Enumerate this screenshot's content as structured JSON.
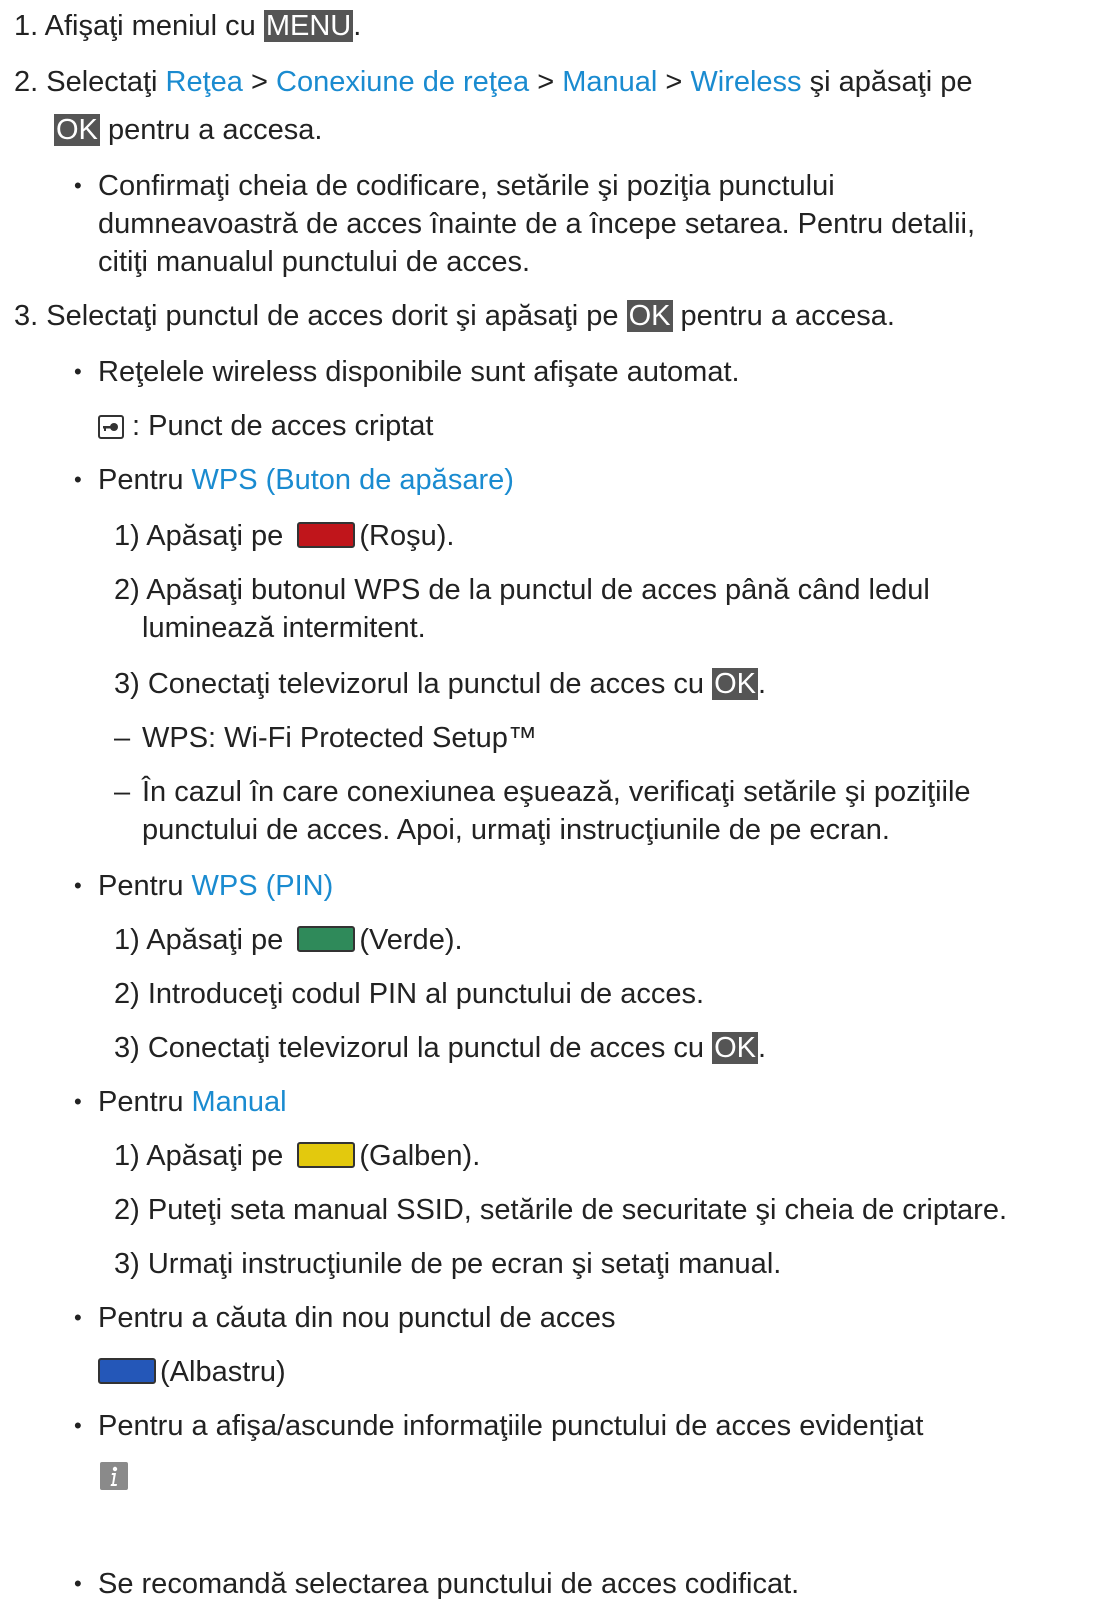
{
  "steps": [
    {
      "num": "1.",
      "pre": "Afişaţi meniul cu ",
      "key": "MENU",
      "post": "."
    },
    {
      "num": "2.",
      "pre": "Selectaţi ",
      "path": [
        "Reţea",
        "Conexiune de reţea",
        "Manual",
        "Wireless"
      ],
      "sep": " > ",
      "post": " şi apăsaţi pe",
      "key": "OK",
      "post2": " pentru a accesa.",
      "note": [
        "Confirmaţi cheia de codificare, setările şi poziţia punctului",
        "dumneavoastră de acces înainte de a începe setarea. Pentru detalii,",
        "citiţi manualul punctului de acces."
      ]
    },
    {
      "num": "3.",
      "pre": "Selectaţi punctul de acces dorit şi apăsaţi pe ",
      "key": "OK",
      "post": " pentru a accesa."
    }
  ],
  "step3": {
    "auto_note": "Reţelele wireless disponibile sunt afişate automat.",
    "lock_note": " : Punct de acces criptat",
    "wps_button": {
      "pre": "Pentru ",
      "link": "WPS (Buton de apăsare)",
      "s1_num": "1)",
      "s1_pre": "Apăsaţi pe ",
      "s1_post": "(Roşu).",
      "s2_num": "2)",
      "s2": [
        "Apăsaţi butonul WPS de la punctul de acces până când ledul",
        "luminează intermitent."
      ],
      "s3_num": "3)",
      "s3_pre": "Conectaţi televizorul la punctul de acces cu ",
      "s3_key": "OK",
      "s3_post": ".",
      "dash1": "WPS: Wi-Fi Protected Setup™",
      "dash2": [
        "În cazul în care conexiunea eşuează, verificaţi setările şi poziţiile",
        "punctului de acces. Apoi, urmaţi instrucţiunile de pe ecran."
      ]
    },
    "wps_pin": {
      "pre": "Pentru ",
      "link": "WPS (PIN)",
      "s1_num": "1)",
      "s1_pre": "Apăsaţi pe ",
      "s1_post": "(Verde).",
      "s2_num": "2)",
      "s2": "Introduceţi codul PIN al punctului de acces.",
      "s3_num": "3)",
      "s3_pre": "Conectaţi televizorul la punctul de acces cu ",
      "s3_key": "OK",
      "s3_post": "."
    },
    "manual": {
      "pre": "Pentru ",
      "link": "Manual",
      "s1_num": "1)",
      "s1_pre": "Apăsaţi pe ",
      "s1_post": "(Galben).",
      "s2_num": "2)",
      "s2": "Puteţi seta manual SSID, setările de securitate şi cheia de criptare.",
      "s3_num": "3)",
      "s3": "Urmaţi instrucţiunile de pe ecran şi setaţi manual."
    },
    "search": {
      "text": "Pentru a căuta din nou punctul de acces",
      "key_label": "(Albastru)"
    },
    "info": {
      "text": "Pentru a afişa/ascunde informaţiile punctului de acces evidenţiat"
    },
    "recommend": "Se recomandă selectarea punctului de acces codificat."
  },
  "bullet_char": "•",
  "dash_char": "–",
  "colors": {
    "link": "#1a8bd0",
    "key_bg": "#555555",
    "red": "#c0151b",
    "green": "#2f8a5a",
    "yellow": "#e3c90d",
    "blue": "#2457b8"
  }
}
